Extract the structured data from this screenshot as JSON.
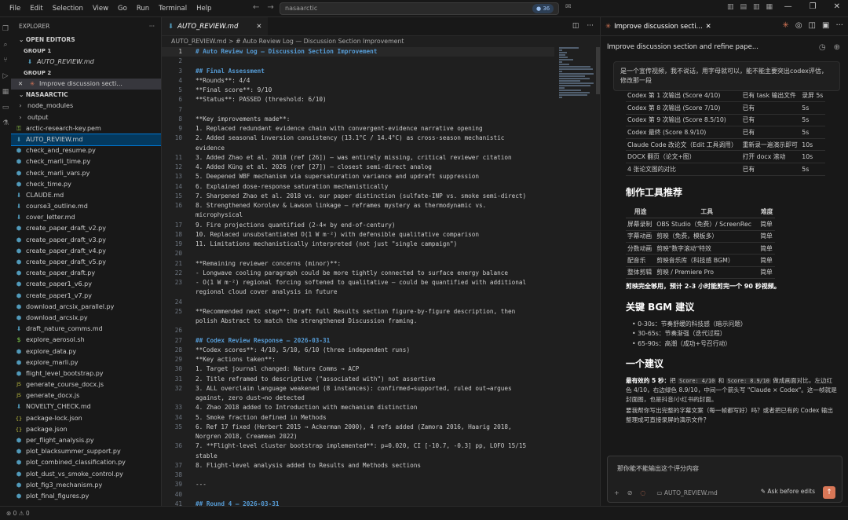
{
  "menu": [
    "File",
    "Edit",
    "Selection",
    "View",
    "Go",
    "Run",
    "Terminal",
    "Help"
  ],
  "search": {
    "text": "nasaarctic"
  },
  "badge": "36",
  "explorer": {
    "title": "EXPLORER",
    "open_editors": "OPEN EDITORS",
    "group1": "GROUP 1",
    "group1_file": "AUTO_REVIEW.md",
    "group2": "GROUP 2",
    "group2_file": "Improve discussion secti...",
    "project": "NASAARCTIC",
    "items": [
      {
        "label": "node_modules",
        "icon": "folder"
      },
      {
        "label": "output",
        "icon": "folder"
      },
      {
        "label": "arctic-research-key.pem",
        "icon": "pem"
      },
      {
        "label": "AUTO_REVIEW.md",
        "icon": "md"
      },
      {
        "label": "check_and_resume.py",
        "icon": "py"
      },
      {
        "label": "check_marli_time.py",
        "icon": "py"
      },
      {
        "label": "check_marli_vars.py",
        "icon": "py"
      },
      {
        "label": "check_time.py",
        "icon": "py"
      },
      {
        "label": "CLAUDE.md",
        "icon": "md"
      },
      {
        "label": "course3_outline.md",
        "icon": "md"
      },
      {
        "label": "cover_letter.md",
        "icon": "md"
      },
      {
        "label": "create_paper_draft_v2.py",
        "icon": "py"
      },
      {
        "label": "create_paper_draft_v3.py",
        "icon": "py"
      },
      {
        "label": "create_paper_draft_v4.py",
        "icon": "py"
      },
      {
        "label": "create_paper_draft_v5.py",
        "icon": "py"
      },
      {
        "label": "create_paper_draft.py",
        "icon": "py"
      },
      {
        "label": "create_paper1_v6.py",
        "icon": "py"
      },
      {
        "label": "create_paper1_v7.py",
        "icon": "py"
      },
      {
        "label": "download_arcsix_parallel.py",
        "icon": "py"
      },
      {
        "label": "download_arcsix.py",
        "icon": "py"
      },
      {
        "label": "draft_nature_comms.md",
        "icon": "md"
      },
      {
        "label": "explore_aerosol.sh",
        "icon": "sh"
      },
      {
        "label": "explore_data.py",
        "icon": "py"
      },
      {
        "label": "explore_marli.py",
        "icon": "py"
      },
      {
        "label": "flight_level_bootstrap.py",
        "icon": "py"
      },
      {
        "label": "generate_course_docx.js",
        "icon": "js"
      },
      {
        "label": "generate_docx.js",
        "icon": "js"
      },
      {
        "label": "NOVELTY_CHECK.md",
        "icon": "md"
      },
      {
        "label": "package-lock.json",
        "icon": "json"
      },
      {
        "label": "package.json",
        "icon": "json"
      },
      {
        "label": "per_flight_analysis.py",
        "icon": "py"
      },
      {
        "label": "plot_blacksummer_support.py",
        "icon": "py"
      },
      {
        "label": "plot_combined_classification.py",
        "icon": "py"
      },
      {
        "label": "plot_dust_vs_smoke_control.py",
        "icon": "py"
      },
      {
        "label": "plot_fig3_mechanism.py",
        "icon": "py"
      },
      {
        "label": "plot_final_figures.py",
        "icon": "py"
      }
    ]
  },
  "editor": {
    "tab": "AUTO_REVIEW.md",
    "breadcrumb": "AUTO_REVIEW.md  >  # Auto Review Log — Discussion Section Improvement",
    "lines": [
      {
        "n": "1",
        "t": "# Auto Review Log — Discussion Section Improvement"
      },
      {
        "n": "2",
        "t": ""
      },
      {
        "n": "3",
        "t": "## Final Assessment"
      },
      {
        "n": "4",
        "t": "**Rounds**: 4/4"
      },
      {
        "n": "5",
        "t": "**Final score**: 9/10"
      },
      {
        "n": "6",
        "t": "**Status**: PASSED (threshold: 6/10)"
      },
      {
        "n": "7",
        "t": ""
      },
      {
        "n": "8",
        "t": "**Key improvements made**:"
      },
      {
        "n": "9",
        "t": "1. Replaced redundant evidence chain with convergent-evidence narrative opening"
      },
      {
        "n": "10",
        "t": "2. Added seasonal inversion consistency (13.1°C / 14.4°C) as cross-season mechanistic"
      },
      {
        "n": "",
        "t": "evidence"
      },
      {
        "n": "11",
        "t": "3. Added Zhao et al. 2018 (ref [26]) — was entirely missing, critical reviewer citation"
      },
      {
        "n": "12",
        "t": "4. Added Küng et al. 2026 (ref [27]) — closest semi-direct analog"
      },
      {
        "n": "13",
        "t": "5. Deepened WBF mechanism via supersaturation variance and updraft suppression"
      },
      {
        "n": "14",
        "t": "6. Explained dose-response saturation mechanistically"
      },
      {
        "n": "15",
        "t": "7. Sharpened Zhao et al. 2018 vs. our paper distinction (sulfate-INP vs. smoke semi-direct)"
      },
      {
        "n": "16",
        "t": "8. Strengthened Korolev & Lawson linkage — reframes mystery as thermodynamic vs."
      },
      {
        "n": "",
        "t": "microphysical"
      },
      {
        "n": "17",
        "t": "9. Fire projections quantified (2-4× by end-of-century)"
      },
      {
        "n": "18",
        "t": "10. Replaced unsubstantiated O(1 W m⁻²) with defensible qualitative comparison"
      },
      {
        "n": "19",
        "t": "11. Limitations mechanistically interpreted (not just \"single campaign\")"
      },
      {
        "n": "20",
        "t": ""
      },
      {
        "n": "21",
        "t": "**Remaining reviewer concerns (minor)**:"
      },
      {
        "n": "22",
        "t": "- Longwave cooling paragraph could be more tightly connected to surface energy balance"
      },
      {
        "n": "23",
        "t": "- O(1 W m⁻²) regional forcing softened to qualitative — could be quantified with additional"
      },
      {
        "n": "",
        "t": "regional cloud cover analysis in future"
      },
      {
        "n": "24",
        "t": ""
      },
      {
        "n": "25",
        "t": "**Recommended next step**: Draft full Results section figure-by-figure description, then"
      },
      {
        "n": "",
        "t": "polish Abstract to match the strengthened Discussion framing."
      },
      {
        "n": "26",
        "t": ""
      },
      {
        "n": "27",
        "t": "## Codex Review Response — 2026-03-31"
      },
      {
        "n": "28",
        "t": "**Codex scores**: 4/10, 5/10, 6/10 (three independent runs)"
      },
      {
        "n": "29",
        "t": "**Key actions taken**:"
      },
      {
        "n": "30",
        "t": "1. Target journal changed: Nature Comms → ACP"
      },
      {
        "n": "31",
        "t": "2. Title reframed to descriptive (\"associated with\") not assertive"
      },
      {
        "n": "32",
        "t": "3. ALL overclaim language weakened (8 instances): confirmed→supported, ruled out→argues"
      },
      {
        "n": "",
        "t": "against, zero dust→no detected"
      },
      {
        "n": "33",
        "t": "4. Zhao 2018 added to Introduction with mechanism distinction"
      },
      {
        "n": "34",
        "t": "5. Smoke fraction defined in Methods"
      },
      {
        "n": "35",
        "t": "6. Ref 17 fixed (Herbert 2015 → Ackerman 2000), 4 refs added (Zamora 2016, Haarig 2018,"
      },
      {
        "n": "",
        "t": "Norgren 2018, Creamean 2022)"
      },
      {
        "n": "36",
        "t": "7. **Flight-level cluster bootstrap implemented**: p=0.020, CI [-10.7, -0.3] pp, LOFO 15/15"
      },
      {
        "n": "",
        "t": "stable"
      },
      {
        "n": "37",
        "t": "8. Flight-level analysis added to Results and Methods sections"
      },
      {
        "n": "38",
        "t": ""
      },
      {
        "n": "39",
        "t": "---"
      },
      {
        "n": "40",
        "t": ""
      },
      {
        "n": "41",
        "t": "## Round 4 — 2026-03-31"
      }
    ]
  },
  "chat": {
    "tab": "Improve discussion secti...",
    "title": "Improve discussion section and refine pape...",
    "user_msg": "是一个宣传视频，我不说话，用字母就可以，能不能主要突出codex评估，修改那一段",
    "table1": [
      [
        "Codex 第 1 次输出 (Score 4/10)",
        "已有 task 输出文件",
        "录屏 5s"
      ],
      [
        "Codex 第 8 次输出 (Score 7/10)",
        "已有",
        "5s"
      ],
      [
        "Codex 第 9 次输出 (Score 8.5/10)",
        "已有",
        "5s"
      ],
      [
        "Codex 最终 (Score 8.9/10)",
        "已有",
        "5s"
      ],
      [
        "Claude Code 改论文（Edit 工具调用）",
        "重新录一遍演示即可",
        "10s"
      ],
      [
        "DOCX 翻页（论文+图）",
        "打开 docx 滚动",
        "10s"
      ],
      [
        "4 张论文图的对比",
        "已有",
        "5s"
      ]
    ],
    "h_tools": "制作工具推荐",
    "t2_head": [
      "用途",
      "工具",
      "难度"
    ],
    "table2": [
      [
        "屏幕录制",
        "OBS Studio（免费）/ ScreenRec",
        "简单"
      ],
      [
        "字幕动画",
        "剪映（免费，模板多）",
        "简单"
      ],
      [
        "分数动画",
        "剪映\"数字滚动\"特效",
        "简单"
      ],
      [
        "配音乐",
        "剪映音乐库（科技感 BGM）",
        "简单"
      ],
      [
        "整体剪辑",
        "剪映 / Premiere Pro",
        "简单"
      ]
    ],
    "summary": "剪映完全够用，预计 2-3 小时能剪完一个 90 秒视频。",
    "h_bgm": "关键 BGM 建议",
    "bgm": [
      "0-30s：节奏舒缓的科技感（暗示问题）",
      "30-65s：节奏渐强（迭代过程）",
      "65-90s：高潮（成功+号召行动）"
    ],
    "h_advice": "一个建议",
    "advice_lead": "最有效的 5 秒：",
    "advice_pre": "把",
    "chip1": "Score: 4/10",
    "advice_and": "和",
    "chip2": "Score: 8.9/10",
    "advice_rest": "做成画面对比，左边红色 4/10，右边绿色 8.9/10，中间一个箭头写 \"Claude × Codex\"。这一帧就是封面图，也是抖音/小红书的封面。",
    "advice_q": "要我帮你写出完整的字幕文案（每一帧都写好）吗？或者把已有的 Codex 输出整理成可直接录屏的演示文件？",
    "input_text": "那你能不能输出这个评分内容",
    "input_file": "AUTO_REVIEW.md",
    "ask_label": "Ask before edits"
  },
  "status": {
    "text": "⊗ 0 ⚠ 0"
  }
}
